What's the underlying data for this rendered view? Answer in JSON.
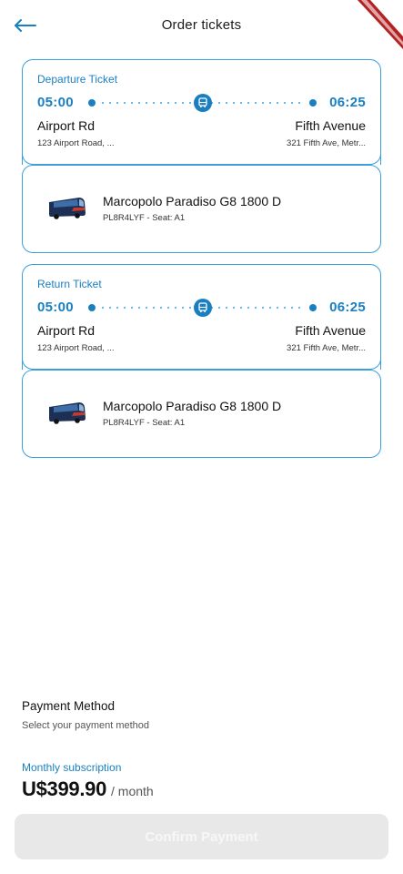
{
  "header": {
    "title": "Order tickets",
    "back_icon": "arrow-left-icon",
    "accent": "#1a7fc1"
  },
  "tickets": [
    {
      "label": "Departure Ticket",
      "departure_time": "05:00",
      "arrival_time": "06:25",
      "from_station": "Airport Rd",
      "from_address": "123 Airport Road, ...",
      "to_station": "Fifth Avenue",
      "to_address": "321 Fifth Ave, Metr...",
      "bus_name": "Marcopolo Paradiso G8 1800 D",
      "bus_meta": "PL8R4LYF - Seat: A1"
    },
    {
      "label": "Return Ticket",
      "departure_time": "05:00",
      "arrival_time": "06:25",
      "from_station": "Airport Rd",
      "from_address": "123 Airport Road, ...",
      "to_station": "Fifth Avenue",
      "to_address": "321 Fifth Ave, Metr...",
      "bus_name": "Marcopolo Paradiso G8 1800 D",
      "bus_meta": "PL8R4LYF - Seat: A1"
    }
  ],
  "payment": {
    "title": "Payment Method",
    "subtitle": "Select your payment method",
    "plan_label": "Monthly subscription",
    "price": "U$399.90",
    "period": "/ month"
  },
  "confirm_button": {
    "label": "Confirm Payment"
  },
  "colors": {
    "border": "#3aa0dc",
    "button_disabled": "#e8e8e8"
  }
}
